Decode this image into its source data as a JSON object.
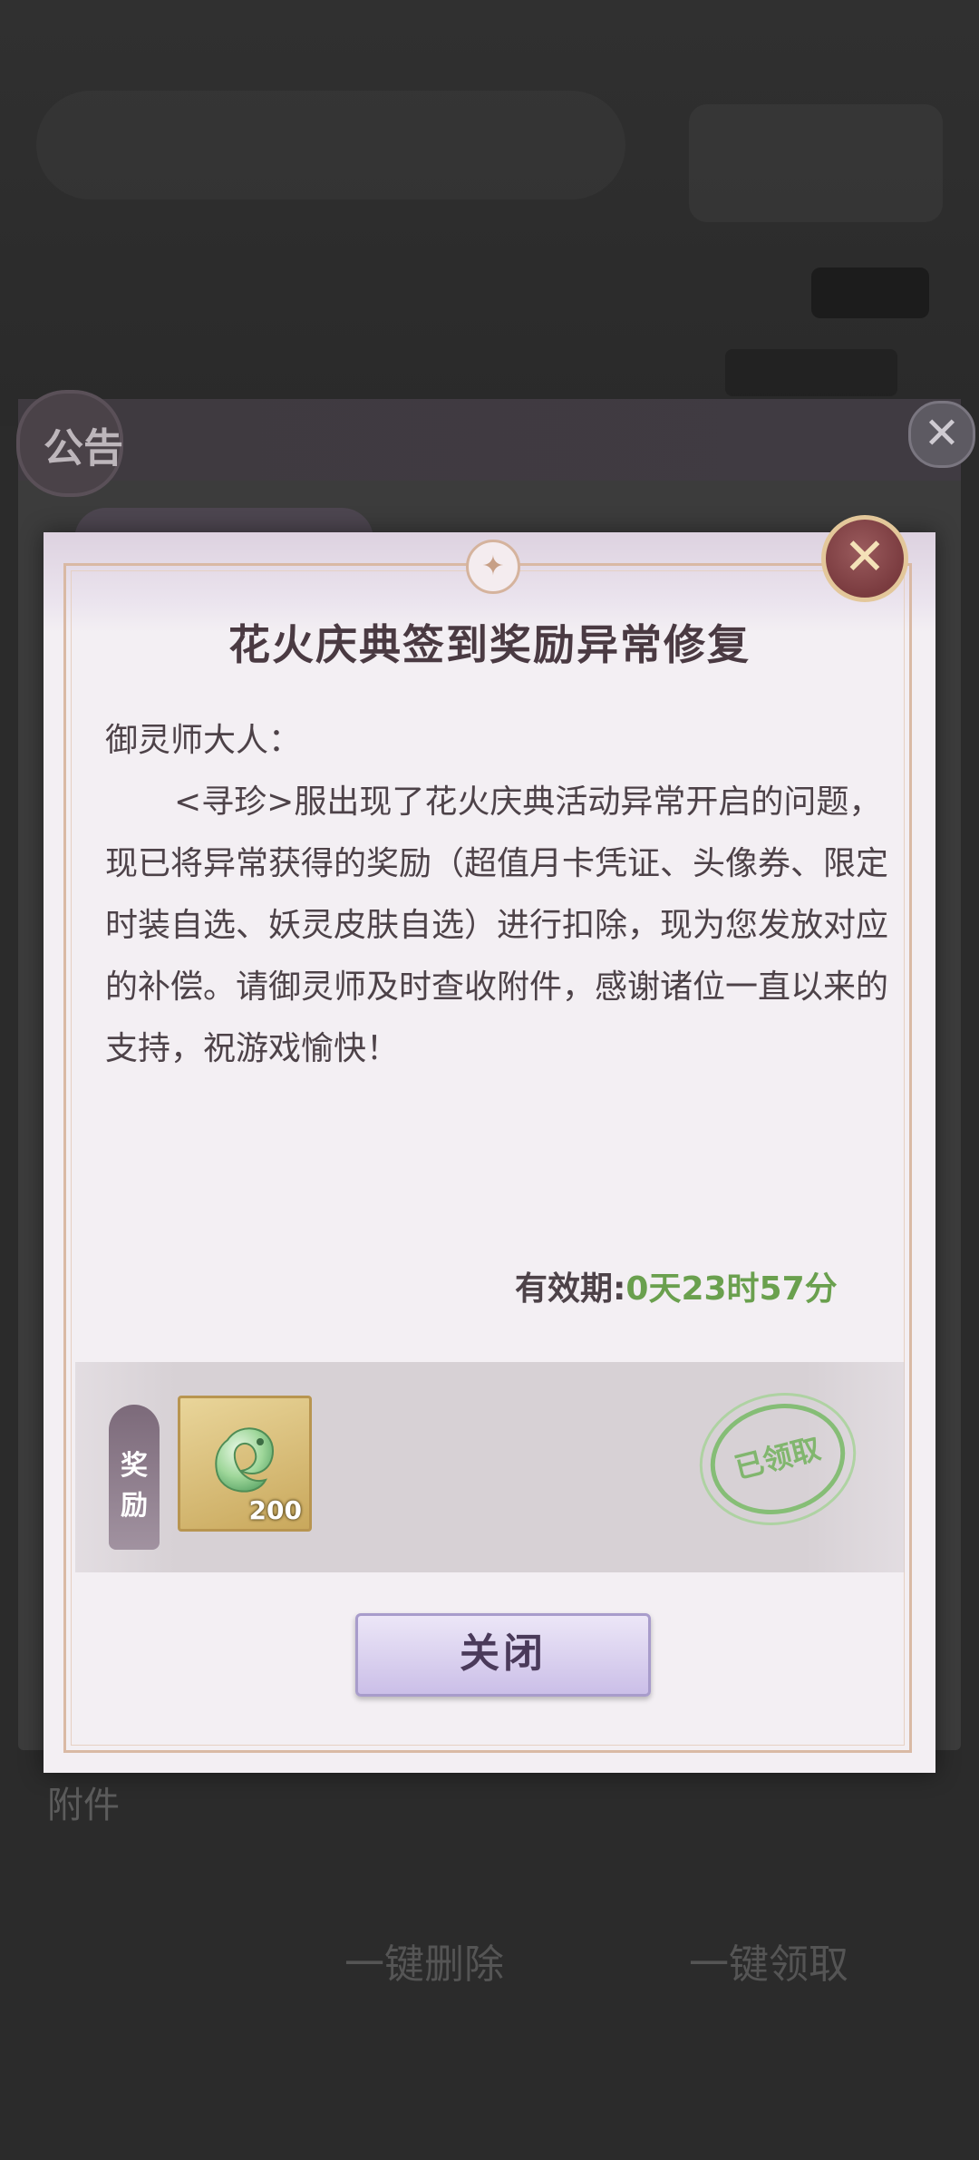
{
  "background": {
    "panel_title": "公告",
    "footer_label": "附件",
    "btn_delete_all": "一键删除",
    "btn_claim_all": "一键领取"
  },
  "modal": {
    "title": "花火庆典签到奖励异常修复",
    "greeting": "御灵师大人：",
    "paragraph": "<寻珍>服出现了花火庆典活动异常开启的问题，现已将异常获得的奖励（超值月卡凭证、头像券、限定时装自选、妖灵皮肤自选）进行扣除，现为您发放对应的补偿。请御灵师及时查收附件，感谢诸位一直以来的支持，祝游戏愉快！",
    "validity_label": "有效期:",
    "validity_value": "0天23时57分",
    "reward_tag_1": "奖",
    "reward_tag_2": "励",
    "reward_count": "200",
    "claimed_stamp": "已领取",
    "close_button": "关闭",
    "close_icon": "✕"
  },
  "colors": {
    "validity_value": "#6aa04e",
    "stamp": "#78b463",
    "modal_bg": "#f3eff3"
  }
}
